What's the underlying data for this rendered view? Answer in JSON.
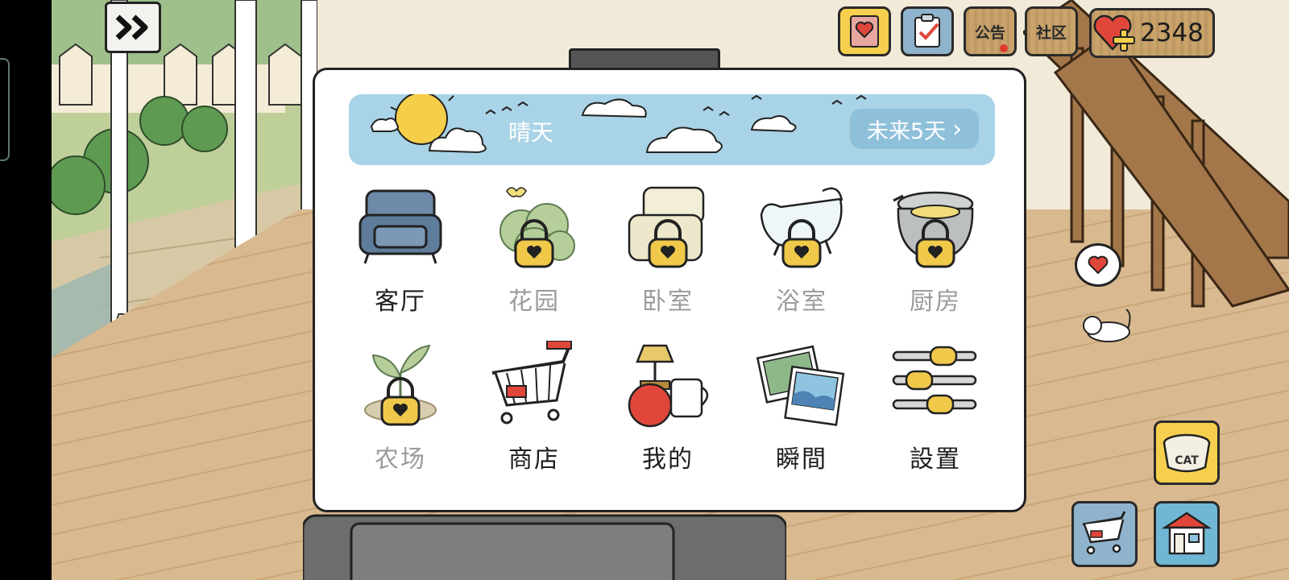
{
  "weather": {
    "label": "晴天",
    "forecast_label": "未来5天",
    "forecast_chevron": "›"
  },
  "hud": {
    "notice_label": "公告",
    "community_label": "社区",
    "hearts_count": "2348"
  },
  "menu": {
    "items": [
      {
        "label": "客厅",
        "icon": "sofa-icon",
        "locked": false
      },
      {
        "label": "花园",
        "icon": "bush-icon",
        "locked": true
      },
      {
        "label": "卧室",
        "icon": "pillow-icon",
        "locked": true
      },
      {
        "label": "浴室",
        "icon": "bathtub-icon",
        "locked": true
      },
      {
        "label": "厨房",
        "icon": "pot-icon",
        "locked": true
      },
      {
        "label": "农场",
        "icon": "sprout-icon",
        "locked": true
      },
      {
        "label": "商店",
        "icon": "shopping-cart-icon",
        "locked": false
      },
      {
        "label": "我的",
        "icon": "lamp-mug-icon",
        "locked": false
      },
      {
        "label": "瞬間",
        "icon": "photos-icon",
        "locked": false
      },
      {
        "label": "設置",
        "icon": "sliders-icon",
        "locked": false
      }
    ]
  },
  "cat_bowl_label": "CAT",
  "colors": {
    "hud_yellow": "#f5cf4d",
    "hud_blue": "#8fb3cc",
    "wood": "#caa36a",
    "sky": "#a9d3e6",
    "lock_gold": "#f0c94a",
    "heart_red": "#e0473a"
  }
}
